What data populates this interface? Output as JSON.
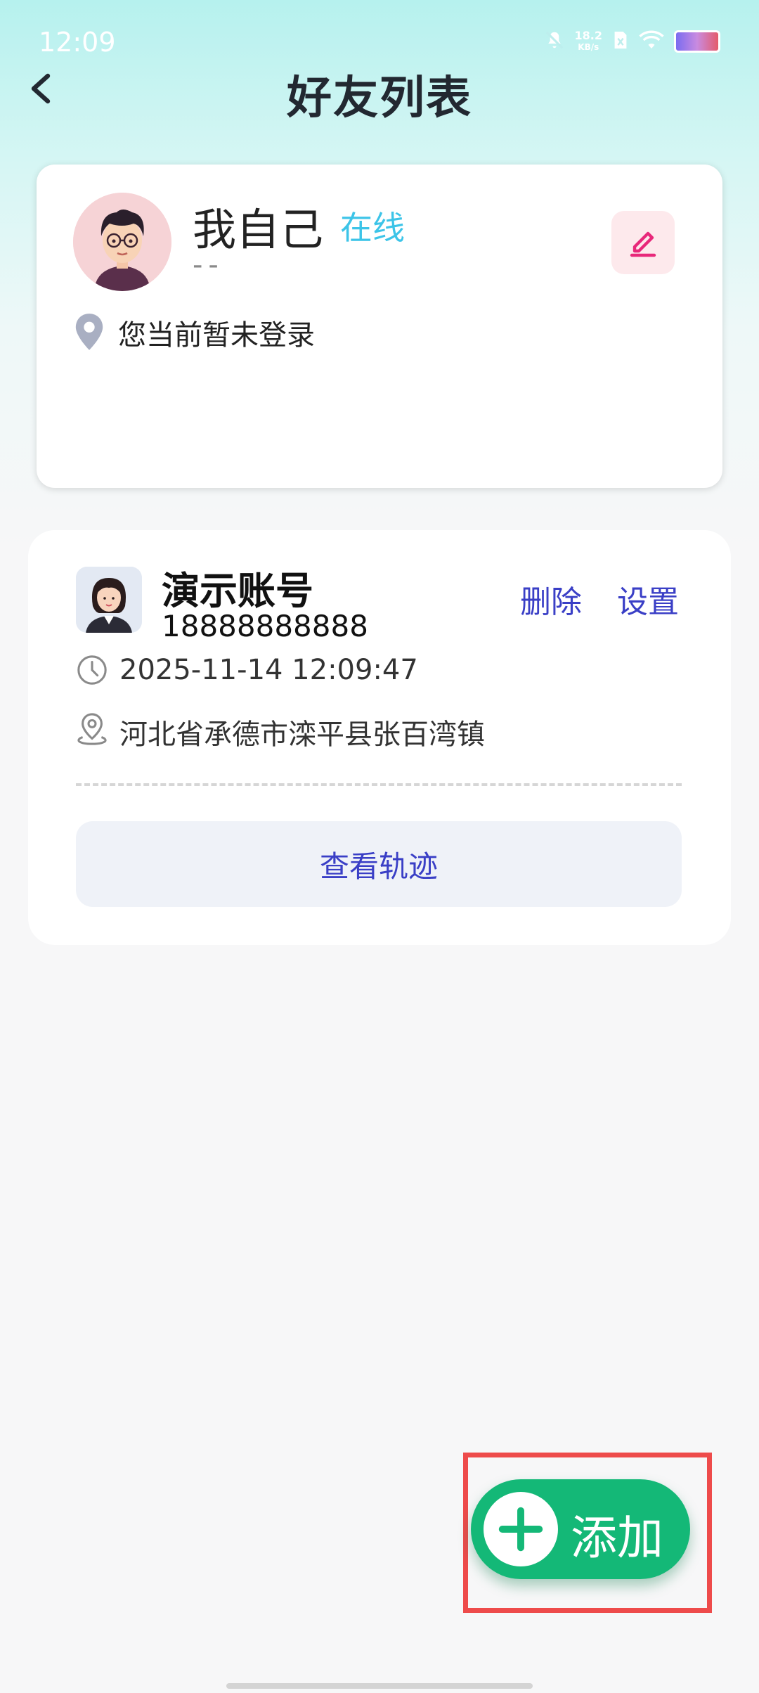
{
  "status_bar": {
    "time": "12:09",
    "speed_value": "18.2",
    "speed_unit": "KB/s",
    "icons": [
      "mute-bell-icon",
      "sim-card-icon",
      "wifi-icon",
      "battery-icon"
    ]
  },
  "header": {
    "title": "好友列表",
    "back_icon": "chevron-left-icon"
  },
  "self_card": {
    "name": "我自己",
    "status": "在线",
    "subtitle": "--",
    "location_text": "您当前暂未登录",
    "edit_icon": "pencil-icon",
    "location_icon": "location-pin-icon",
    "colors": {
      "status": "#3cc4e8",
      "edit_icon": "#e8287a",
      "edit_bg": "#fde9ec"
    }
  },
  "friends": [
    {
      "name": "演示账号",
      "phone": "18888888888",
      "time": "2025-11-14 12:09:47",
      "location": "河北省承德市滦平县张百湾镇",
      "delete_label": "删除",
      "settings_label": "设置",
      "track_label": "查看轨迹",
      "time_icon": "clock-icon",
      "location_icon": "location-outline-icon",
      "action_color": "#3a3fc6"
    }
  ],
  "fab": {
    "label": "添加",
    "icon": "plus-icon",
    "color": "#14b877"
  }
}
